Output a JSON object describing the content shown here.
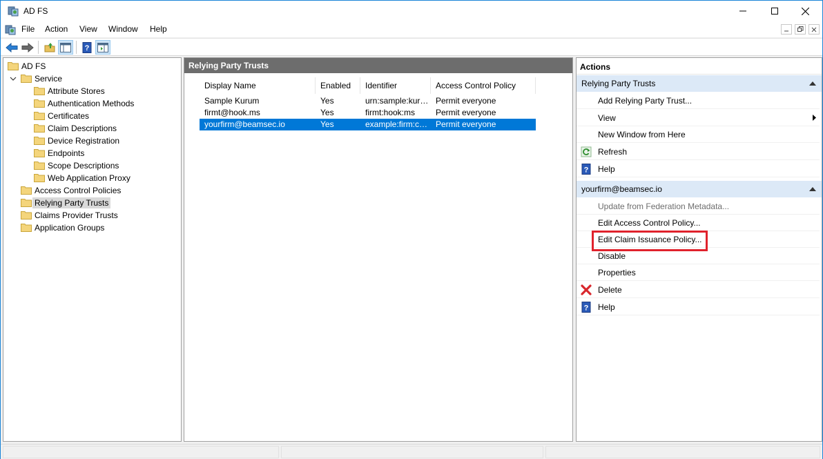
{
  "window": {
    "title": "AD FS",
    "controls": {
      "minimize_icon": "minimize-icon",
      "maximize_icon": "maximize-icon",
      "close_icon": "close-icon"
    }
  },
  "menubar": {
    "items": [
      "File",
      "Action",
      "View",
      "Window",
      "Help"
    ]
  },
  "tree": {
    "root": "AD FS",
    "service": "Service",
    "service_children": [
      "Attribute Stores",
      "Authentication Methods",
      "Certificates",
      "Claim Descriptions",
      "Device Registration",
      "Endpoints",
      "Scope Descriptions",
      "Web Application Proxy"
    ],
    "top_items": [
      "Access Control Policies",
      "Relying Party Trusts",
      "Claims Provider Trusts",
      "Application Groups"
    ],
    "selected": "Relying Party Trusts"
  },
  "center": {
    "header": "Relying Party Trusts",
    "columns": [
      "Display Name",
      "Enabled",
      "Identifier",
      "Access Control Policy"
    ],
    "rows": [
      {
        "name": "Sample Kurum",
        "enabled": "Yes",
        "identifier": "urn:sample:kuru...",
        "policy": "Permit everyone"
      },
      {
        "name": "firmt@hook.ms",
        "enabled": "Yes",
        "identifier": "firmt:hook:ms",
        "policy": "Permit everyone"
      },
      {
        "name": "yourfirm@beamsec.io",
        "enabled": "Yes",
        "identifier": "example:firm:com",
        "policy": "Permit everyone"
      }
    ],
    "selected_row": 2
  },
  "actions": {
    "title": "Actions",
    "section1": {
      "title": "Relying Party Trusts",
      "items": [
        "Add Relying Party Trust...",
        "View",
        "New Window from Here",
        "Refresh",
        "Help"
      ]
    },
    "section2": {
      "title": "yourfirm@beamsec.io",
      "items": [
        "Update from Federation Metadata...",
        "Edit Access Control Policy...",
        "Edit Claim Issuance Policy...",
        "Disable",
        "Properties",
        "Delete",
        "Help"
      ]
    },
    "highlighted_item": "Edit Claim Issuance Policy...",
    "highlight_color": "#e0222c"
  },
  "colors": {
    "selection": "#0078d7",
    "section_bg": "#dce9f7",
    "center_header_bg": "#6d6d6d"
  }
}
